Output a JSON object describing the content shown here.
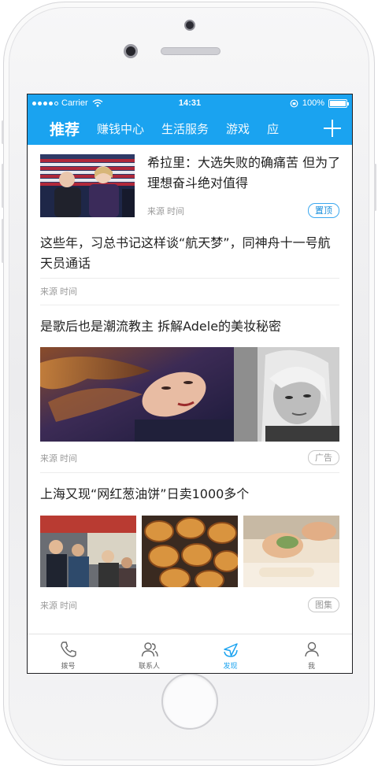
{
  "status_bar": {
    "carrier": "Carrier",
    "time": "14:31",
    "battery": "100%"
  },
  "nav": {
    "tabs": [
      {
        "label": "推荐",
        "active": true
      },
      {
        "label": "赚钱中心",
        "active": false
      },
      {
        "label": "生活服务",
        "active": false
      },
      {
        "label": "游戏",
        "active": false
      },
      {
        "label": "应",
        "active": false
      }
    ],
    "add_icon": "plus-icon",
    "accent_color": "#1aa3f0"
  },
  "feed": {
    "items": [
      {
        "title": "希拉里：大选失败的确痛苦 但为了理想奋斗绝对值得",
        "meta": "来源 时间",
        "tag": "置顶"
      },
      {
        "title": "这些年，习总书记这样谈“航天梦”，同神舟十一号航天员通话",
        "meta": "来源 时间"
      },
      {
        "title": "是歌后也是潮流教主 拆解Adele的美妆秘密",
        "meta": "来源 时间",
        "tag": "广告"
      },
      {
        "title": "上海又现“网红葱油饼”日卖1000多个",
        "meta": "来源 时间",
        "tag": "图集"
      }
    ]
  },
  "tab_bar": {
    "items": [
      {
        "label": "拨号",
        "icon": "phone-icon",
        "active": false
      },
      {
        "label": "联系人",
        "icon": "contacts-icon",
        "active": false
      },
      {
        "label": "发现",
        "icon": "discover-icon",
        "active": true
      },
      {
        "label": "我",
        "icon": "profile-icon",
        "active": false
      }
    ]
  }
}
